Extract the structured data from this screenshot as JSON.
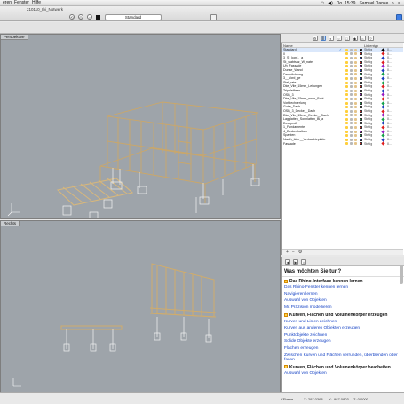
{
  "menubar": {
    "items": [
      "eren",
      "Fenster",
      "Hilfe"
    ],
    "clock": "Do. 15:39",
    "user": "Samuel Danke"
  },
  "window": {
    "document": "210110_Ibi_Notwerk"
  },
  "toolbar": {
    "layer_value": "Standard"
  },
  "viewports": [
    {
      "tab": "Perspektive"
    },
    {
      "tab": "Rechts"
    }
  ],
  "layers": {
    "header": {
      "name": "Name",
      "linetype": "Linientyp"
    },
    "rows": [
      {
        "name": "Standard",
        "mat": "Stetig",
        "color": "#000000",
        "dia": "#000000",
        "sel": true
      },
      {
        "name": "0",
        "mat": "Stetig",
        "color": "#e02020",
        "dia": "#e02020"
      },
      {
        "name": "3_SI_konf.._a",
        "mat": "Stetig",
        "color": "#1e3fbf",
        "dia": "#1e3fbf"
      },
      {
        "name": "St_wabtsaz_W_nate",
        "mat": "Stetig",
        "color": "#e02020",
        "dia": "#e02020"
      },
      {
        "name": "Uh_Fassade",
        "mat": "Stetig",
        "color": "#9a1ec4",
        "dia": "#9a1ec4"
      },
      {
        "name": "Dunse_Wand",
        "mat": "Stetig",
        "color": "#1e3fbf",
        "dia": "#1e3fbf"
      },
      {
        "name": "Dachdichtung",
        "mat": "Stetig",
        "color": "#15a34a",
        "dia": "#15a34a"
      },
      {
        "name": "3__Vord_ge",
        "mat": "Stetig",
        "color": "#1e3fbf",
        "dia": "#1e3fbf"
      },
      {
        "name": "Stel_rate",
        "mat": "Stetig",
        "color": "#15a34a",
        "dia": "#15a34a"
      },
      {
        "name": "Dke_Vile_15mm_Leitungen",
        "mat": "Stetig",
        "color": "#e02020",
        "dia": "#e02020"
      },
      {
        "name": "Tripelstileen",
        "mat": "Stetig",
        "color": "#1e3fbf",
        "dia": "#1e3fbf"
      },
      {
        "name": "OSB_3",
        "mat": "Stetig",
        "color": "#9a1ec4",
        "dia": "#9a1ec4"
      },
      {
        "name": "Dke_Vile_15mm_nnen_Bcht",
        "mat": "Stetig",
        "color": "#e02020",
        "dia": "#e02020"
      },
      {
        "name": "Vorblechverlung",
        "mat": "Stetig",
        "color": "#15a34a",
        "dia": "#15a34a"
      },
      {
        "name": "Gutte_Dach",
        "mat": "Stetig",
        "color": "#1e3fbf",
        "dia": "#1e3fbf"
      },
      {
        "name": "OSB_3_Decke__Dach",
        "mat": "Stetig",
        "color": "#e02020",
        "dia": "#e02020"
      },
      {
        "name": "Dke_Vile_15mm_Decke__Dach",
        "mat": "Stetig",
        "color": "#9a1ec4",
        "dia": "#9a1ec4"
      },
      {
        "name": "Lagglatten_Sonnlatten_Bl_a",
        "mat": "Stetig",
        "color": "#15a34a",
        "dia": "#15a34a"
      },
      {
        "name": "Deckprofil",
        "mat": "Stetig",
        "color": "#1e3fbf",
        "dia": "#1e3fbf"
      },
      {
        "name": "1_Fundamente",
        "mat": "Stetig",
        "color": "#e02020",
        "dia": "#e02020"
      },
      {
        "name": "4_Deckenbalken",
        "mat": "Stetig",
        "color": "#9a1ec4",
        "dia": "#9a1ec4"
      },
      {
        "name": "Spanten",
        "mat": "Stetig",
        "color": "#15a34a",
        "dia": "#15a34a"
      },
      {
        "name": "Naath_tider__Verkaebteplatte",
        "mat": "Stetig",
        "color": "#1e3fbf",
        "dia": "#1e3fbf"
      },
      {
        "name": "Fassade",
        "mat": "Stetig",
        "color": "#e02020",
        "dia": "#e02020"
      }
    ]
  },
  "help": {
    "title": "Was möchten Sie tun?",
    "sections": [
      {
        "heading": "Das Rhino-Interface kennen lernen",
        "links": [
          "Das Rhino-Fenster kennen lernen",
          "Navigieren lernen",
          "Auswahl von Objekten",
          "Mit Präzision modellieren"
        ]
      },
      {
        "heading": "Kurven, Flächen und Volumenkörper erzeugen",
        "links": [
          "Kurven und Linien zeichnen",
          "Kurven aus anderen Objekten erzeugen",
          "Punktobjekte zeichnen",
          "Solide Objekte erzeugen",
          "Flächen erzeugen",
          "Zwischen Kurven und Flächen verrunden, überblenden oder fasen"
        ]
      },
      {
        "heading": "Kurven, Flächen und Volumenkörper bearbeiten",
        "links": [
          "Auswahl von Objekten"
        ]
      }
    ]
  },
  "status": {
    "cplane": "KEbene",
    "x": "X: 297.0368",
    "y": "Y: -987.0803",
    "z": "Z: 0.0000"
  }
}
